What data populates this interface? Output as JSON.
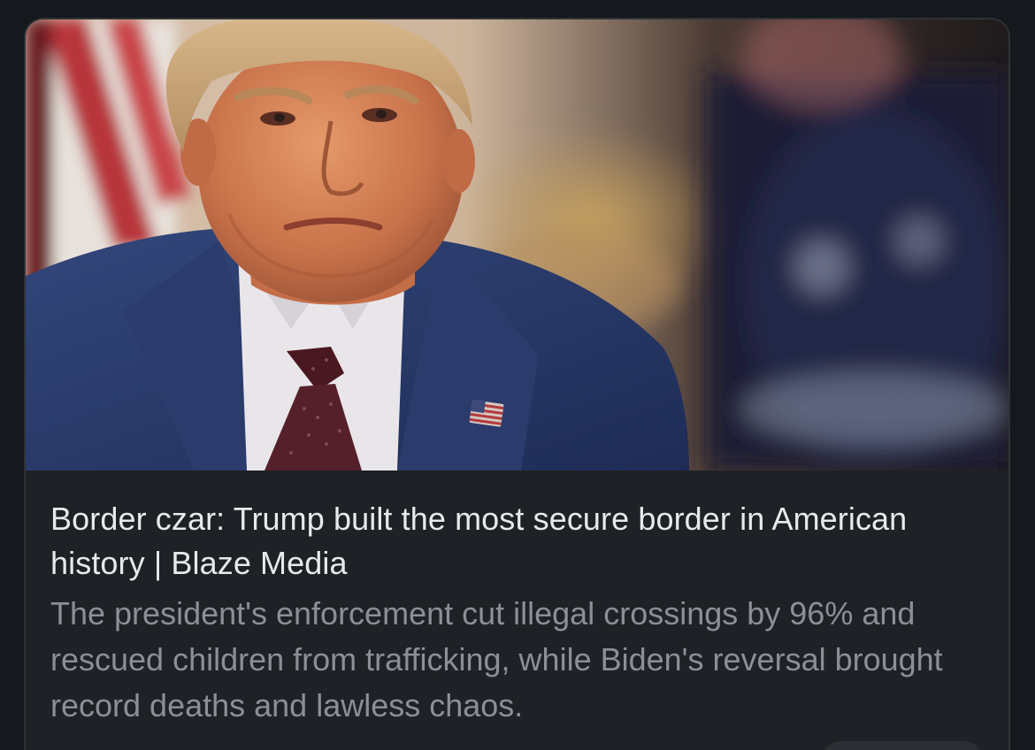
{
  "card": {
    "image_subject": "man-in-navy-suit-with-flag-pin",
    "headline": "Border czar: Trump built the most secure border in American history | Blaze Media",
    "description": "The president's enforcement cut illegal crossings by 96% and rescued children from trafficking, while Biden's reversal brought record deaths and lawless chaos."
  },
  "colors": {
    "background": "#15181c",
    "card_background": "#1e2125",
    "card_border": "#2f3336",
    "headline_text": "#e7e9ea",
    "description_text": "#8b9096"
  }
}
